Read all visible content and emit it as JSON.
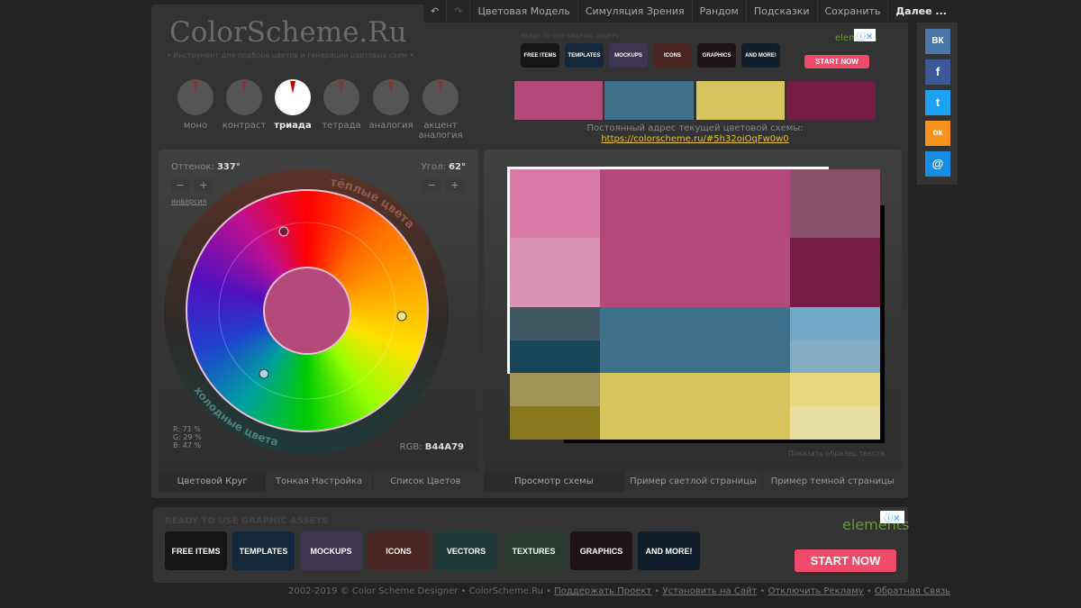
{
  "nav": {
    "undo": "↶",
    "redo": "↷",
    "items": [
      "Цветовая Модель",
      "Симуляция Зрения",
      "Рандом",
      "Подсказки",
      "Сохранить"
    ],
    "more": "Далее ..."
  },
  "logo": "ColorScheme.Ru",
  "tagline": "• Инструмент для подбора цветов и генерации цветовых схем •",
  "schemes": [
    "моно",
    "контраст",
    "триада",
    "тетрада",
    "аналогия",
    "акцент аналогия"
  ],
  "active_scheme": "триада",
  "ad_top": {
    "heading": "READY TO USE GRAPHIC ASSETS",
    "tiles": [
      "FREE ITEMS",
      "TEMPLATES",
      "MOCKUPS",
      "ICONS",
      "GRAPHICS",
      "AND MORE!"
    ],
    "brand": "elements",
    "cta": "START NOW"
  },
  "swatches": [
    "#B44A79",
    "#3D728A",
    "#D7C45C",
    "#741C43"
  ],
  "permalink": {
    "label": "Постоянный адрес текущей цветовой схемы:",
    "url": "https://colorscheme.ru/#5h32oiOqFw0w0"
  },
  "wheel": {
    "hue_label": "Оттенок:",
    "hue": "337°",
    "angle_label": "Угол:",
    "angle": "62°",
    "minus": "−",
    "plus": "+",
    "invert": "инверсия",
    "warm": "тёплые цвета",
    "cold": "холодные цвета",
    "r": "R: 71 %",
    "g": "G: 29 %",
    "b": "B: 47 %",
    "rgb_label": "RGB:",
    "rgb": "B44A79",
    "base_color": "#B44A79"
  },
  "left_tabs": [
    "Цветовой Круг",
    "Тонкая Настройка",
    "Список Цветов"
  ],
  "preview": {
    "show_text": "Показать образец текста",
    "colors": {
      "p1": "#D97BA6",
      "p2": "#D893B3",
      "pm": "#B44A79",
      "p3": "#8A506A",
      "p4": "#741C43",
      "b1": "#3F5864",
      "b2": "#184558",
      "bm": "#3D728A",
      "b3": "#71A9C7",
      "b4": "#84ADC2",
      "y1": "#A19456",
      "y2": "#8A781E",
      "ym": "#D7C45C",
      "y3": "#E8D880",
      "y4": "#EADFA2"
    }
  },
  "right_tabs": [
    "Просмотр схемы",
    "Пример светлой страницы",
    "Пример темной страницы"
  ],
  "social": [
    "ВК",
    "f",
    "t",
    "ок",
    "@"
  ],
  "ad_bottom": {
    "heading": "READY TO USE GRAPHIC ASSETS",
    "tiles": [
      "FREE ITEMS",
      "TEMPLATES",
      "MOCKUPS",
      "ICONS",
      "VECTORS",
      "TEXTURES",
      "GRAPHICS",
      "AND MORE!"
    ],
    "brand": "elements",
    "cta": "START NOW"
  },
  "footer": {
    "copy": "2002-2019 © Color Scheme Designer • ColorScheme.Ru •",
    "links": [
      "Поддержать Проект",
      "Установить на Сайт",
      "Отключить Рекламу",
      "Обратная Связь"
    ]
  }
}
